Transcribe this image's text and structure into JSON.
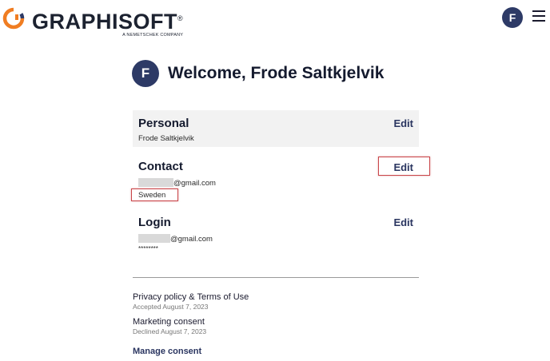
{
  "brand": {
    "name": "GRAPHISOFT",
    "trademark": "®",
    "tagline": "A NEMETSCHEK COMPANY",
    "logo_colors": {
      "arc": "#f07d22",
      "arc2": "#2d3a66"
    }
  },
  "header": {
    "avatar_initial": "F",
    "menu_icon": "hamburger-icon"
  },
  "welcome": {
    "avatar_initial": "F",
    "title": "Welcome, Frode Saltkjelvik"
  },
  "personal": {
    "title": "Personal",
    "edit_label": "Edit",
    "name": "Frode Saltkjelvik"
  },
  "contact": {
    "title": "Contact",
    "edit_label": "Edit",
    "email_suffix": "@gmail.com",
    "country": "Sweden"
  },
  "login": {
    "title": "Login",
    "edit_label": "Edit",
    "email_suffix": "@gmail.com",
    "password_mask": "********"
  },
  "consents": {
    "privacy_title": "Privacy policy & Terms of Use",
    "privacy_status": "Accepted August 7, 2023",
    "marketing_title": "Marketing consent",
    "marketing_status": "Declined August 7, 2023",
    "manage_label": "Manage consent"
  },
  "colors": {
    "accent": "#2d3a66",
    "highlight": "#c9464a",
    "section_bg": "#f2f2f2"
  }
}
